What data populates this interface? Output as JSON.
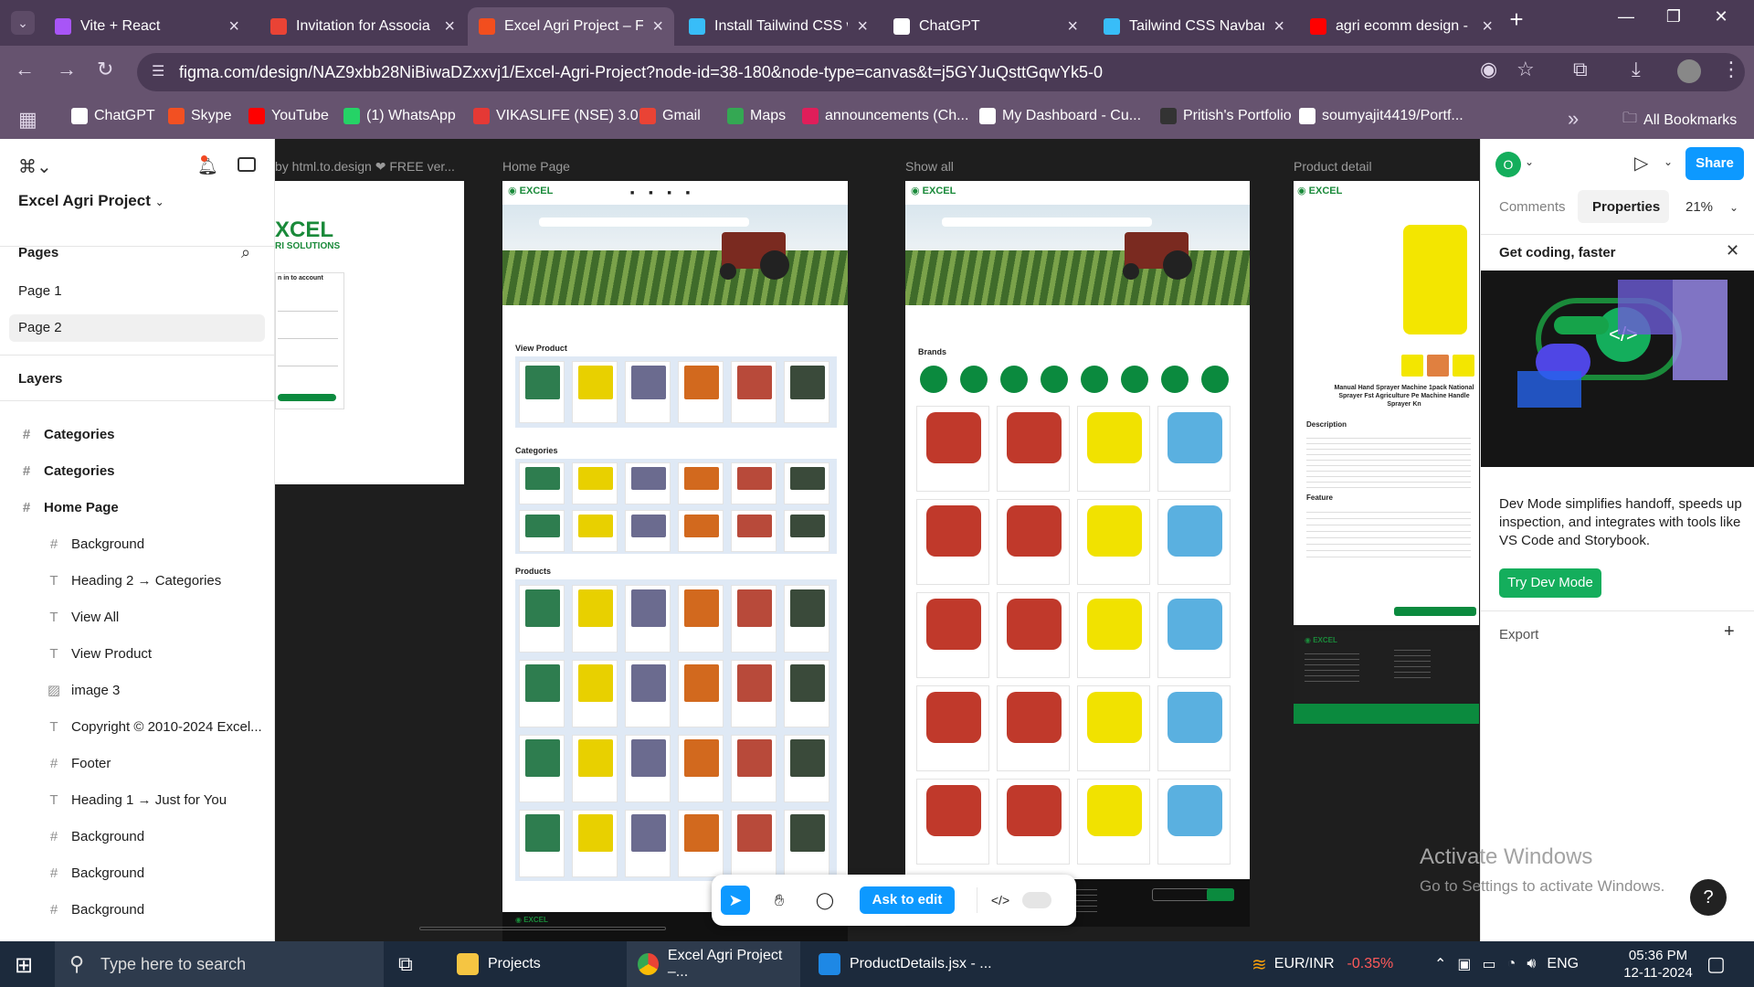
{
  "browser": {
    "tabs": [
      {
        "title": "Vite + React",
        "color": "#a855f7"
      },
      {
        "title": "Invitation for Associa",
        "color": "#ea4335"
      },
      {
        "title": "Excel Agri Project – Fi",
        "color": "#f24e1e"
      },
      {
        "title": "Install Tailwind CSS w",
        "color": "#38bdf8"
      },
      {
        "title": "ChatGPT",
        "color": "#ffffff"
      },
      {
        "title": "Tailwind CSS Navbars",
        "color": "#38bdf8"
      },
      {
        "title": "agri ecomm design -",
        "color": "#ff0000"
      }
    ],
    "url": "figma.com/design/NAZ9xbb28NiBiwaDZxxvj1/Excel-Agri-Project?node-id=38-180&node-type=canvas&t=j5GYJuQsttGqwYk5-0",
    "bookmarks": [
      {
        "label": "ChatGPT",
        "color": "#ffffff"
      },
      {
        "label": "Skype",
        "color": "#f25022"
      },
      {
        "label": "YouTube",
        "color": "#ff0000"
      },
      {
        "label": "(1) WhatsApp",
        "color": "#25d366"
      },
      {
        "label": "VIKASLIFE (NSE) 3.0...",
        "color": "#e53935"
      },
      {
        "label": "Gmail",
        "color": "#ea4335"
      },
      {
        "label": "Maps",
        "color": "#34a853"
      },
      {
        "label": "announcements (Ch...",
        "color": "#e01e5a"
      },
      {
        "label": "My Dashboard - Cu...",
        "color": "#ffffff"
      },
      {
        "label": "Pritish's Portfolio",
        "color": "#333333"
      },
      {
        "label": "soumyajit4419/Portf...",
        "color": "#ffffff"
      }
    ],
    "all_bookmarks": "All Bookmarks"
  },
  "figma": {
    "project_name": "Excel Agri Project",
    "pages_heading": "Pages",
    "pages": [
      "Page 1",
      "Page 2"
    ],
    "layers_heading": "Layers",
    "layers": [
      {
        "label": "Categories",
        "type": "frame",
        "level": "top"
      },
      {
        "label": "Categories",
        "type": "frame",
        "level": "top"
      },
      {
        "label": "Home Page",
        "type": "frame",
        "level": "top"
      },
      {
        "label": "Background",
        "type": "frame",
        "level": "sub"
      },
      {
        "label": "Heading 2 → Categories",
        "type": "text",
        "level": "sub"
      },
      {
        "label": "View All",
        "type": "text",
        "level": "sub"
      },
      {
        "label": "View Product",
        "type": "text",
        "level": "sub"
      },
      {
        "label": "image 3",
        "type": "image",
        "level": "sub"
      },
      {
        "label": "Copyright © 2010-2024 Excel...",
        "type": "text",
        "level": "sub"
      },
      {
        "label": "Footer",
        "type": "frame",
        "level": "sub"
      },
      {
        "label": "Heading 1 → Just for You",
        "type": "text",
        "level": "sub"
      },
      {
        "label": "Background",
        "type": "frame",
        "level": "sub"
      },
      {
        "label": "Background",
        "type": "frame",
        "level": "sub"
      },
      {
        "label": "Background",
        "type": "frame",
        "level": "sub"
      }
    ],
    "frame_labels": {
      "login": "by html.to.design ❤ FREE ver...",
      "home": "Home Page",
      "show_all": "Show all",
      "product_detail": "Product detail"
    },
    "canvas_text": {
      "login_brand": "XCEL",
      "login_sub": "RI SOLUTIONS",
      "login_heading": "n in to account",
      "view_product": "View Product",
      "categories": "Categories",
      "products": "Products",
      "brands": "Brands",
      "description": "Description",
      "feature": "Feature",
      "product_title": "Manual Hand Sprayer Machine 1pack National Sprayer Fst Agriculture Pe Machine Handle Sprayer Kn"
    },
    "toolbar": {
      "ask_to_edit": "Ask to edit"
    },
    "right_panel": {
      "avatar_letter": "O",
      "share": "Share",
      "tabs": [
        "Comments",
        "Properties"
      ],
      "zoom": "21%",
      "promo_title": "Get coding, faster",
      "promo_text": "Dev Mode simplifies handoff, speeds up inspection, and integrates with tools like VS Code and Storybook.",
      "promo_button": "Try Dev Mode",
      "export": "Export"
    },
    "watermark": {
      "line1": "Activate Windows",
      "line2": "Go to Settings to activate Windows."
    }
  },
  "taskbar": {
    "search_placeholder": "Type here to search",
    "items": [
      "Projects",
      "Excel Agri Project –...",
      "ProductDetails.jsx - ..."
    ],
    "ticker": "EUR/INR",
    "ticker_change": "-0.35%",
    "lang": "ENG",
    "time": "05:36 PM",
    "date": "12-11-2024"
  }
}
